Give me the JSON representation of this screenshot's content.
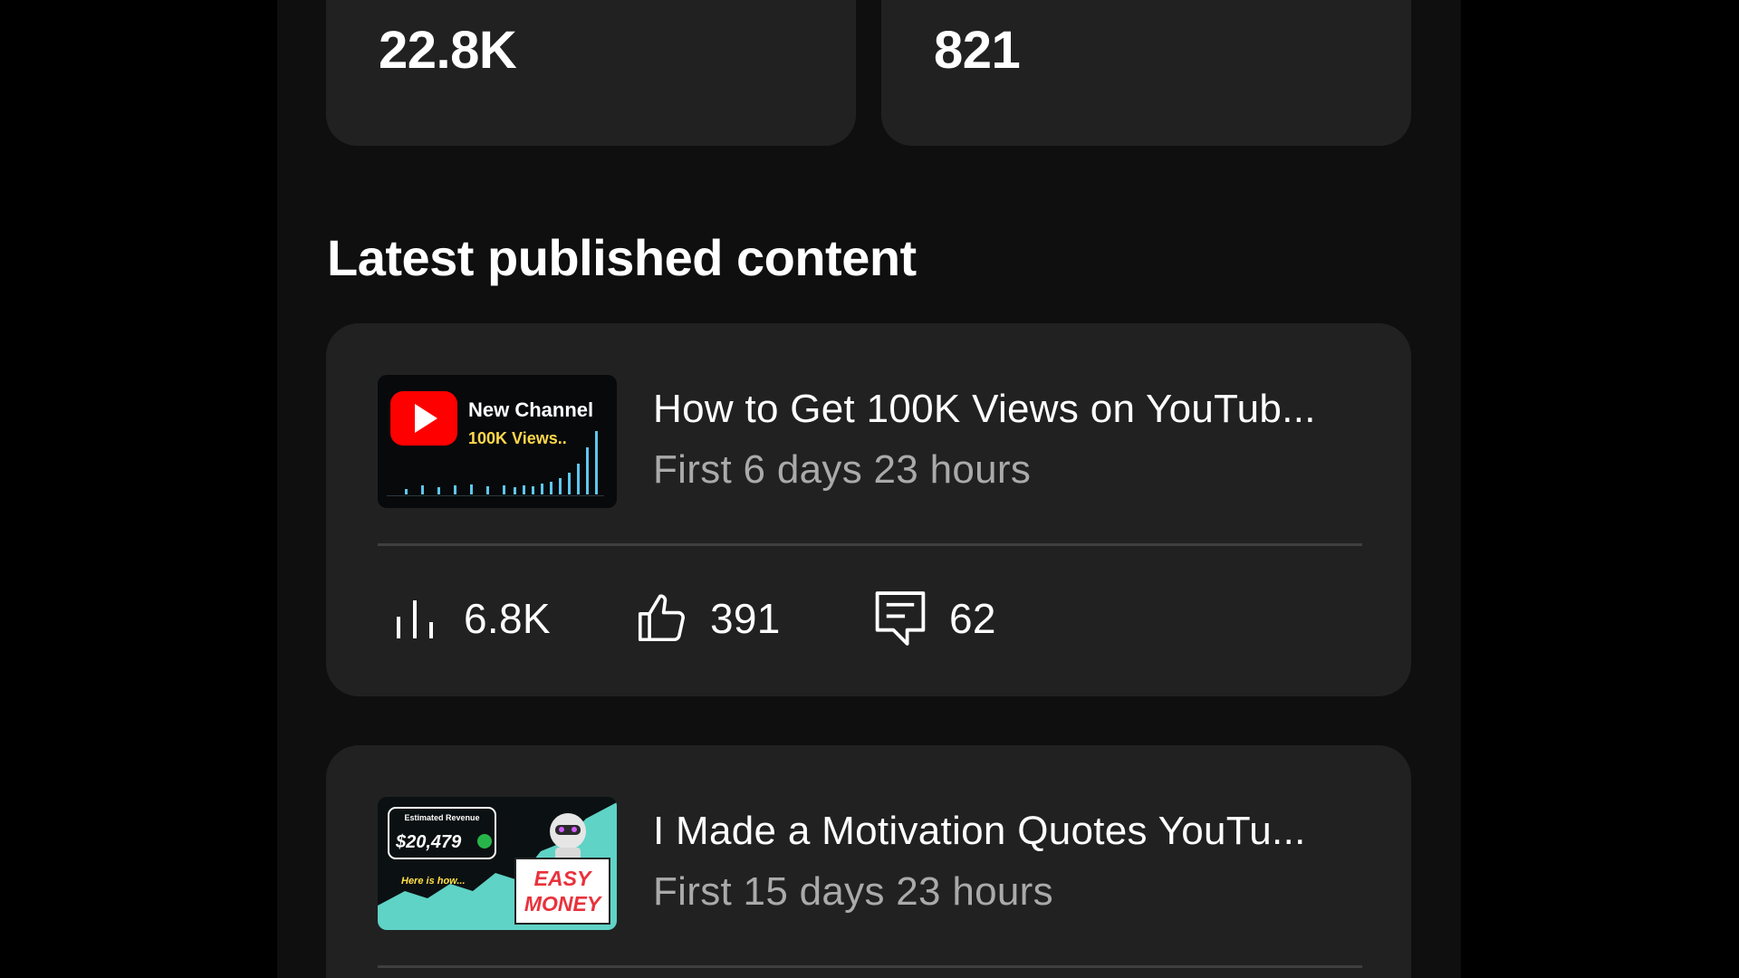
{
  "stats": [
    {
      "label": "",
      "value": "22.8K"
    },
    {
      "label": "",
      "value": "821"
    }
  ],
  "section": {
    "title": "Latest published content"
  },
  "videos": [
    {
      "title": "How to Get 100K Views on YouTub...",
      "subtitle": "First 6 days 23 hours",
      "thumbnail": {
        "line1": "New Channel",
        "line2": "100K Views.."
      },
      "metrics": {
        "views": "6.8K",
        "likes": "391",
        "comments": "62"
      }
    },
    {
      "title": "I Made a Motivation Quotes YouTu...",
      "subtitle": "First 15 days 23 hours",
      "thumbnail": {
        "badge_label": "Estimated Revenue",
        "amount": "$20,479",
        "note": "Here is how...",
        "sign_line1": "EASY",
        "sign_line2": "MONEY"
      }
    }
  ],
  "icons": {
    "views": "bar-chart-icon",
    "likes": "thumbs-up-icon",
    "comments": "comment-icon",
    "play": "youtube-play-icon"
  },
  "colors": {
    "background": "#0f0f0f",
    "card": "#212121",
    "text": "#ffffff",
    "muted": "#aaaaaa",
    "accent": "#ff0000",
    "teal": "#5fd3c6"
  }
}
